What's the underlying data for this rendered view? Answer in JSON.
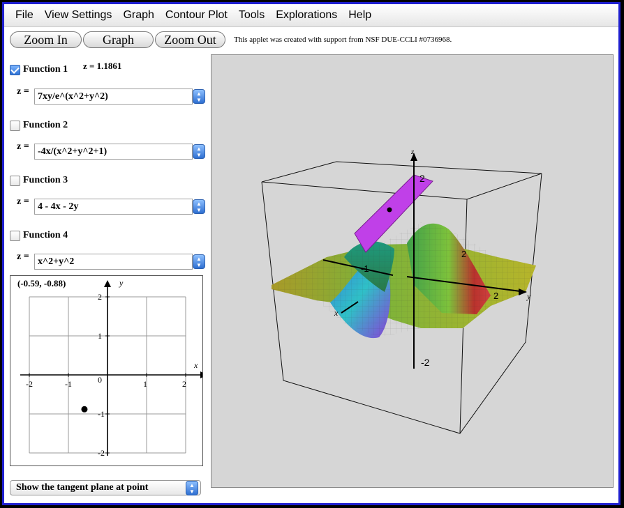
{
  "menu": [
    "File",
    "View Settings",
    "Graph",
    "Contour Plot",
    "Tools",
    "Explorations",
    "Help"
  ],
  "toolbar": {
    "zoom_in": "Zoom In",
    "graph": "Graph",
    "zoom_out": "Zoom Out",
    "credit": "This applet was created with support from NSF DUE-CCLI #0736968."
  },
  "z_readout": "z = 1.1861",
  "functions": [
    {
      "label": "Function 1",
      "checked": true,
      "z_label": "z =",
      "expr": "7xy/e^(x^2+y^2)"
    },
    {
      "label": "Function 2",
      "checked": false,
      "z_label": "z =",
      "expr": "-4x/(x^2+y^2+1)"
    },
    {
      "label": "Function 3",
      "checked": false,
      "z_label": "z =",
      "expr": "4 - 4x - 2y"
    },
    {
      "label": "Function 4",
      "checked": false,
      "z_label": "z =",
      "expr": "x^2+y^2"
    }
  ],
  "domain_plot": {
    "coord_readout": "(-0.59, -0.88)",
    "x_label": "x",
    "y_label": "y",
    "x_ticks": [
      "-2",
      "-1",
      "0",
      "1",
      "2"
    ],
    "y_ticks": [
      "2",
      "1",
      "-1",
      "-2"
    ],
    "point": {
      "x": -0.59,
      "y": -0.88
    }
  },
  "plot3d": {
    "axis_labels": {
      "x": "x",
      "y": "y",
      "z": "z"
    },
    "z_ticks": [
      "2",
      "-2"
    ],
    "y_ticks": [
      "2"
    ],
    "x_ticks": [
      "-1",
      "2"
    ]
  },
  "mode_select": "Show the tangent plane at point",
  "colors": {
    "frame": "#1f1fd0",
    "plot_bg": "#d6d6d6",
    "checkbox": "#2f73d6",
    "tangent_plane": "#c040e8"
  }
}
